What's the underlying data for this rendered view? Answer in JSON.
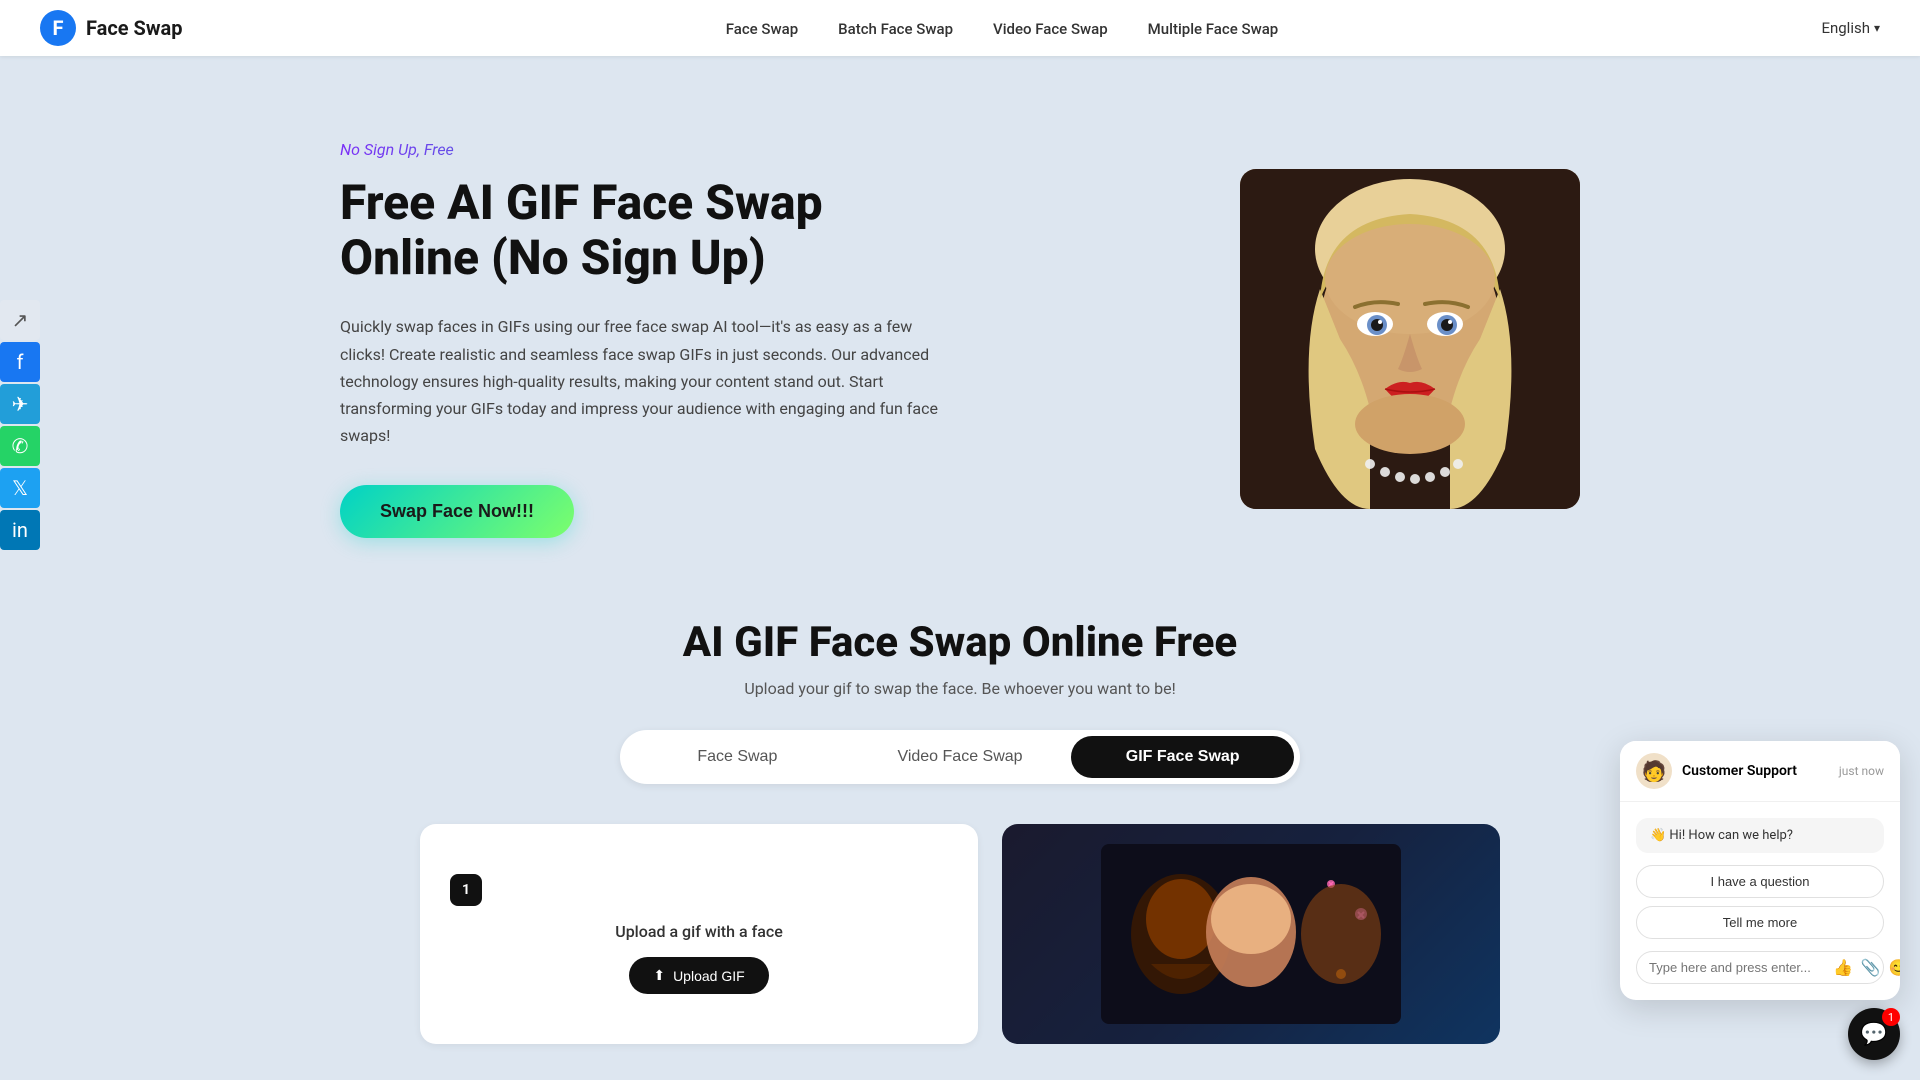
{
  "app": {
    "name": "Face Swap",
    "logo_letter": "F"
  },
  "navbar": {
    "nav_items": [
      {
        "label": "Face Swap",
        "id": "nav-face-swap"
      },
      {
        "label": "Batch Face Swap",
        "id": "nav-batch"
      },
      {
        "label": "Video Face Swap",
        "id": "nav-video"
      },
      {
        "label": "Multiple Face Swap",
        "id": "nav-multiple"
      }
    ],
    "language": "English"
  },
  "social_sidebar": {
    "items": [
      {
        "label": "Share",
        "icon": "share",
        "symbol": "↗"
      },
      {
        "label": "Facebook",
        "icon": "facebook",
        "symbol": "f"
      },
      {
        "label": "Telegram",
        "icon": "telegram",
        "symbol": "✈"
      },
      {
        "label": "WhatsApp",
        "icon": "whatsapp",
        "symbol": "✆"
      },
      {
        "label": "Twitter",
        "icon": "twitter",
        "symbol": "𝕏"
      },
      {
        "label": "LinkedIn",
        "icon": "linkedin",
        "symbol": "in"
      }
    ]
  },
  "hero": {
    "badge": "No Sign Up, Free",
    "title": "Free AI GIF Face Swap Online (No Sign Up)",
    "description": "Quickly swap faces in GIFs using our free face swap AI tool—it's as easy as a few clicks! Create realistic and seamless face swap GIFs in just seconds. Our advanced technology ensures high-quality results, making your content stand out. Start transforming your GIFs today and impress your audience with engaging and fun face swaps!",
    "cta_button": "Swap Face Now!!!"
  },
  "section": {
    "title": "AI GIF Face Swap Online Free",
    "subtitle": "Upload your gif to swap the face. Be whoever you want to be!"
  },
  "tabs": [
    {
      "label": "Face Swap",
      "id": "tab-face-swap",
      "active": false
    },
    {
      "label": "Video Face Swap",
      "id": "tab-video",
      "active": false
    },
    {
      "label": "GIF Face Swap",
      "id": "tab-gif",
      "active": true
    }
  ],
  "upload": {
    "step": "1",
    "label": "Upload a gif with a face",
    "button_label": "Upload GIF",
    "upload_icon": "⬆"
  },
  "chat": {
    "agent_name": "Customer Support",
    "agent_emoji": "🧑",
    "time": "just now",
    "message": "👋 Hi! How can we help?",
    "quick_replies": [
      "I have a question",
      "Tell me more"
    ],
    "input_placeholder": "Type here and press enter...",
    "badge": "1"
  }
}
